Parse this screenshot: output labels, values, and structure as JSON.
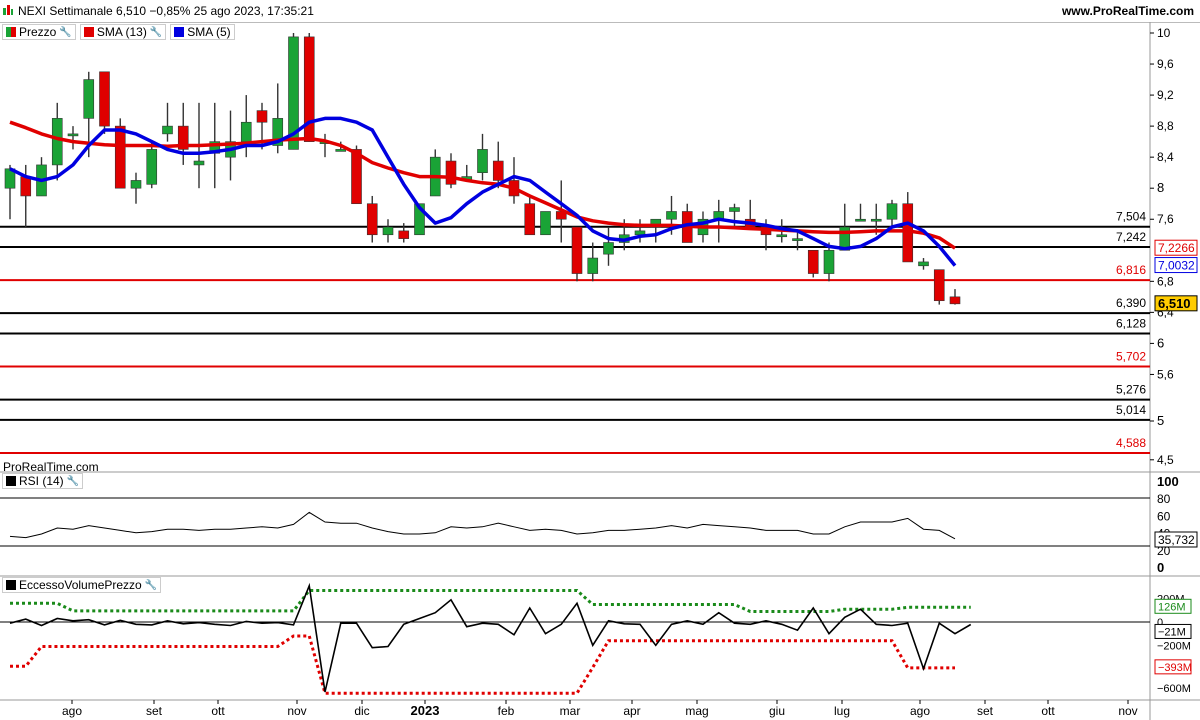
{
  "header": {
    "title": "NEXI Settimanale 6,510 −0,85% 25 ago 2023, 17:35:21",
    "site": "www.ProRealTime.com"
  },
  "price_panel": {
    "legend": [
      {
        "label": "Prezzo",
        "color": "#1aa336"
      },
      {
        "label": "SMA (13)",
        "color": "#e00000"
      },
      {
        "label": "SMA (5)",
        "color": "#0000e0"
      }
    ],
    "watermark": "ProRealTime.com",
    "axis_ticks": [
      "10",
      "9,6",
      "9,2",
      "8,8",
      "8,4",
      "8",
      "7,6",
      "6,8",
      "6,4",
      "6",
      "5,6",
      "5",
      "4,5"
    ],
    "levels": [
      {
        "label": "7,504",
        "value": 7.504,
        "color": "#000000"
      },
      {
        "label": "7,242",
        "value": 7.242,
        "color": "#000000"
      },
      {
        "label": "6,816",
        "value": 6.816,
        "color": "#e00000"
      },
      {
        "label": "6,390",
        "value": 6.39,
        "color": "#000000"
      },
      {
        "label": "6,128",
        "value": 6.128,
        "color": "#000000"
      },
      {
        "label": "5,702",
        "value": 5.702,
        "color": "#e00000"
      },
      {
        "label": "5,276",
        "value": 5.276,
        "color": "#000000"
      },
      {
        "label": "5,014",
        "value": 5.014,
        "color": "#000000"
      },
      {
        "label": "4,588",
        "value": 4.588,
        "color": "#e00000"
      }
    ],
    "tags": [
      {
        "text": "7,2266",
        "color": "#e00000"
      },
      {
        "text": "7,0032",
        "color": "#0000e0"
      },
      {
        "text": "6,510",
        "color": "#000000",
        "bg": "#ffcc00"
      }
    ]
  },
  "rsi_panel": {
    "legend": "RSI (14)",
    "axis_ticks": [
      "100",
      "80",
      "60",
      "40",
      "20",
      "0"
    ],
    "value_tag": "35,732"
  },
  "vol_panel": {
    "legend": "EccessoVolumePrezzo",
    "axis_ticks": [
      "200M",
      "0",
      "−200M",
      "−600M"
    ],
    "tags": [
      {
        "text": "126M",
        "color": "#1a8a1a"
      },
      {
        "text": "−21M",
        "color": "#000000"
      },
      {
        "text": "−393M",
        "color": "#e00000"
      }
    ]
  },
  "x_axis": {
    "labels": [
      "ago",
      "set",
      "ott",
      "nov",
      "dic",
      "2023",
      "feb",
      "mar",
      "apr",
      "mag",
      "giu",
      "lug",
      "ago",
      "set",
      "ott",
      "nov"
    ]
  },
  "chart_data": {
    "type": "candlestick",
    "title": "NEXI Settimanale",
    "colors": {
      "up": "#1aa336",
      "down": "#e00000",
      "sma13": "#e00000",
      "sma5": "#0000e0"
    },
    "ohlc": [
      [
        8.0,
        8.3,
        7.6,
        8.25
      ],
      [
        8.15,
        8.3,
        7.5,
        7.9
      ],
      [
        7.9,
        8.4,
        7.9,
        8.3
      ],
      [
        8.3,
        9.1,
        8.1,
        8.9
      ],
      [
        8.7,
        8.8,
        8.5,
        8.7
      ],
      [
        8.9,
        9.5,
        8.4,
        9.4
      ],
      [
        9.5,
        9.5,
        8.7,
        8.8
      ],
      [
        8.8,
        8.9,
        8.0,
        8.0
      ],
      [
        8.0,
        8.2,
        7.8,
        8.1
      ],
      [
        8.05,
        8.6,
        8.0,
        8.5
      ],
      [
        8.7,
        9.1,
        8.6,
        8.8
      ],
      [
        8.8,
        9.1,
        8.3,
        8.5
      ],
      [
        8.3,
        9.1,
        8.0,
        8.35
      ],
      [
        8.45,
        9.1,
        8.0,
        8.6
      ],
      [
        8.4,
        9.0,
        8.1,
        8.6
      ],
      [
        8.6,
        9.2,
        8.4,
        8.85
      ],
      [
        9.0,
        9.1,
        8.5,
        8.85
      ],
      [
        8.55,
        9.35,
        8.45,
        8.9
      ],
      [
        8.5,
        10.0,
        8.5,
        9.95
      ],
      [
        9.95,
        10.0,
        8.6,
        8.6
      ],
      [
        8.6,
        8.7,
        8.4,
        8.6
      ],
      [
        8.5,
        8.6,
        8.5,
        8.5
      ],
      [
        8.5,
        8.55,
        7.8,
        7.8
      ],
      [
        7.8,
        7.9,
        7.3,
        7.4
      ],
      [
        7.4,
        7.6,
        7.3,
        7.5
      ],
      [
        7.45,
        7.55,
        7.3,
        7.35
      ],
      [
        7.4,
        7.8,
        7.4,
        7.8
      ],
      [
        7.9,
        8.5,
        7.9,
        8.4
      ],
      [
        8.35,
        8.45,
        8.0,
        8.05
      ],
      [
        8.1,
        8.3,
        8.1,
        8.15
      ],
      [
        8.2,
        8.7,
        8.1,
        8.5
      ],
      [
        8.35,
        8.6,
        8.0,
        8.1
      ],
      [
        8.1,
        8.4,
        7.8,
        7.9
      ],
      [
        7.8,
        7.9,
        7.4,
        7.4
      ],
      [
        7.4,
        7.7,
        7.4,
        7.7
      ],
      [
        7.7,
        8.1,
        7.3,
        7.6
      ],
      [
        7.5,
        7.5,
        6.8,
        6.9
      ],
      [
        6.9,
        7.3,
        6.8,
        7.1
      ],
      [
        7.15,
        7.5,
        7.0,
        7.3
      ],
      [
        7.3,
        7.6,
        7.2,
        7.4
      ],
      [
        7.4,
        7.6,
        7.3,
        7.45
      ],
      [
        7.5,
        7.6,
        7.3,
        7.6
      ],
      [
        7.6,
        7.9,
        7.4,
        7.7
      ],
      [
        7.7,
        7.8,
        7.4,
        7.3
      ],
      [
        7.4,
        7.7,
        7.3,
        7.6
      ],
      [
        7.6,
        7.85,
        7.3,
        7.7
      ],
      [
        7.7,
        7.8,
        7.5,
        7.75
      ],
      [
        7.6,
        7.85,
        7.5,
        7.5
      ],
      [
        7.5,
        7.6,
        7.2,
        7.4
      ],
      [
        7.4,
        7.6,
        7.3,
        7.4
      ],
      [
        7.35,
        7.45,
        7.2,
        7.35
      ],
      [
        7.2,
        7.2,
        6.85,
        6.9
      ],
      [
        6.9,
        7.3,
        6.8,
        7.2
      ],
      [
        7.2,
        7.8,
        7.2,
        7.5
      ],
      [
        7.6,
        7.8,
        7.6,
        7.6
      ],
      [
        7.6,
        7.8,
        7.4,
        7.6
      ],
      [
        7.6,
        7.85,
        7.5,
        7.8
      ],
      [
        7.8,
        7.95,
        7.1,
        7.05
      ],
      [
        7.0,
        7.1,
        6.95,
        7.05
      ],
      [
        6.95,
        6.95,
        6.5,
        6.55
      ],
      [
        6.6,
        6.7,
        6.5,
        6.51
      ]
    ],
    "sma13": [
      8.85,
      8.78,
      8.7,
      8.64,
      8.6,
      8.58,
      8.56,
      8.55,
      8.55,
      8.55,
      8.54,
      8.55,
      8.55,
      8.56,
      8.57,
      8.58,
      8.6,
      8.62,
      8.63,
      8.64,
      8.61,
      8.55,
      8.45,
      8.33,
      8.26,
      8.2,
      8.15,
      8.15,
      8.14,
      8.1,
      8.07,
      8.05,
      8.0,
      7.9,
      7.81,
      7.72,
      7.63,
      7.58,
      7.55,
      7.53,
      7.52,
      7.52,
      7.52,
      7.51,
      7.5,
      7.5,
      7.49,
      7.48,
      7.47,
      7.46,
      7.45,
      7.44,
      7.43,
      7.43,
      7.44,
      7.45,
      7.45,
      7.45,
      7.42,
      7.36,
      7.2266
    ],
    "sma5": [
      8.25,
      8.15,
      8.1,
      8.15,
      8.3,
      8.55,
      8.75,
      8.75,
      8.7,
      8.6,
      8.5,
      8.45,
      8.45,
      8.47,
      8.5,
      8.55,
      8.55,
      8.6,
      8.7,
      8.85,
      8.9,
      8.9,
      8.85,
      8.75,
      8.4,
      8.05,
      7.75,
      7.55,
      7.62,
      7.8,
      7.95,
      8.05,
      8.15,
      8.1,
      7.95,
      7.8,
      7.65,
      7.45,
      7.35,
      7.33,
      7.38,
      7.4,
      7.48,
      7.53,
      7.55,
      7.6,
      7.57,
      7.55,
      7.52,
      7.48,
      7.45,
      7.35,
      7.25,
      7.22,
      7.25,
      7.35,
      7.5,
      7.55,
      7.45,
      7.25,
      7.0032
    ],
    "rsi": [
      38,
      37,
      40,
      45,
      44,
      47,
      45,
      43,
      41,
      42,
      44,
      44,
      43,
      44,
      44,
      45,
      46,
      45,
      48,
      58,
      50,
      49,
      49,
      45,
      42,
      40,
      40,
      41,
      46,
      45,
      46,
      49,
      46,
      43,
      44,
      43,
      40,
      41,
      43,
      43,
      44,
      45,
      47,
      45,
      48,
      47,
      46,
      45,
      43,
      43,
      43,
      40,
      40,
      46,
      50,
      50,
      50,
      53,
      44,
      43,
      36
    ],
    "vol_excess": [
      -10,
      25,
      -30,
      30,
      10,
      20,
      -25,
      15,
      -20,
      -25,
      10,
      -15,
      -5,
      -20,
      -30,
      5,
      -10,
      -5,
      -25,
      310,
      -600,
      -10,
      -10,
      -220,
      -210,
      -20,
      30,
      80,
      190,
      -40,
      -10,
      -20,
      -110,
      120,
      -100,
      -20,
      160,
      -200,
      10,
      -15,
      -20,
      -200,
      -20,
      10,
      -20,
      80,
      -10,
      -20,
      10,
      -20,
      -70,
      120,
      -100,
      40,
      110,
      -20,
      -30,
      -10,
      -400,
      -10,
      -100,
      -21
    ],
    "vol_upper": [
      160,
      160,
      160,
      160,
      95,
      95,
      95,
      95,
      95,
      95,
      95,
      95,
      95,
      95,
      95,
      95,
      95,
      95,
      95,
      270,
      270,
      270,
      270,
      270,
      270,
      270,
      270,
      270,
      270,
      270,
      270,
      270,
      270,
      270,
      270,
      270,
      270,
      150,
      150,
      150,
      150,
      150,
      150,
      150,
      150,
      150,
      150,
      90,
      90,
      90,
      90,
      90,
      90,
      110,
      110,
      110,
      110,
      126,
      126,
      126,
      126,
      126
    ],
    "vol_lower": [
      -380,
      -380,
      -210,
      -210,
      -210,
      -210,
      -210,
      -210,
      -210,
      -210,
      -210,
      -210,
      -210,
      -210,
      -210,
      -210,
      -210,
      -210,
      -120,
      -120,
      -610,
      -610,
      -610,
      -610,
      -610,
      -610,
      -610,
      -610,
      -610,
      -610,
      -610,
      -610,
      -610,
      -610,
      -610,
      -610,
      -610,
      -390,
      -160,
      -160,
      -160,
      -160,
      -160,
      -160,
      -160,
      -160,
      -160,
      -160,
      -160,
      -160,
      -160,
      -160,
      -160,
      -160,
      -160,
      -160,
      -160,
      -393,
      -393,
      -393,
      -393
    ]
  }
}
